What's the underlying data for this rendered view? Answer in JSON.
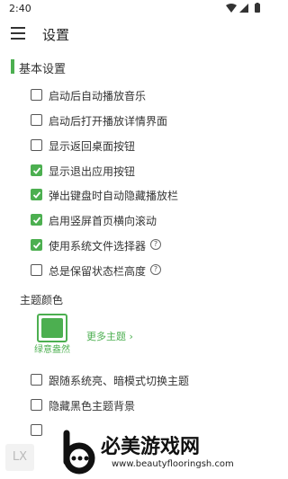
{
  "status_bar": {
    "time": "2:40",
    "icons": [
      "wifi-icon",
      "signal-icon",
      "battery-icon"
    ]
  },
  "toolbar": {
    "title": "设置",
    "menu_icon": "menu-icon"
  },
  "basic_settings": {
    "title": "基本设置",
    "options": [
      {
        "label": "启动后自动播放音乐",
        "checked": false
      },
      {
        "label": "启动后打开播放详情界面",
        "checked": false
      },
      {
        "label": "显示返回桌面按钮",
        "checked": false
      },
      {
        "label": "显示退出应用按钮",
        "checked": true
      },
      {
        "label": "弹出键盘时自动隐藏播放栏",
        "checked": true
      },
      {
        "label": "启用竖屏首页横向滚动",
        "checked": true
      },
      {
        "label": "使用系统文件选择器",
        "checked": true,
        "help": "?"
      },
      {
        "label": "总是保留状态栏高度",
        "checked": false,
        "help": "?"
      }
    ]
  },
  "theme": {
    "title": "主题颜色",
    "current_name": "绿意盎然",
    "current_color": "#4caf50",
    "more_label": "更多主题",
    "options": [
      {
        "label": "跟随系统亮、暗模式切换主题",
        "checked": false
      },
      {
        "label": "隐藏黑色主题背景",
        "checked": false
      },
      {
        "label": "",
        "checked": false
      }
    ]
  },
  "badge": {
    "text": "LX"
  },
  "watermark": {
    "text": "必美游戏网",
    "url": "www.beautyflooringsh.com"
  },
  "colors": {
    "accent": "#4caf50",
    "text": "#333333",
    "background": "#ffffff"
  }
}
